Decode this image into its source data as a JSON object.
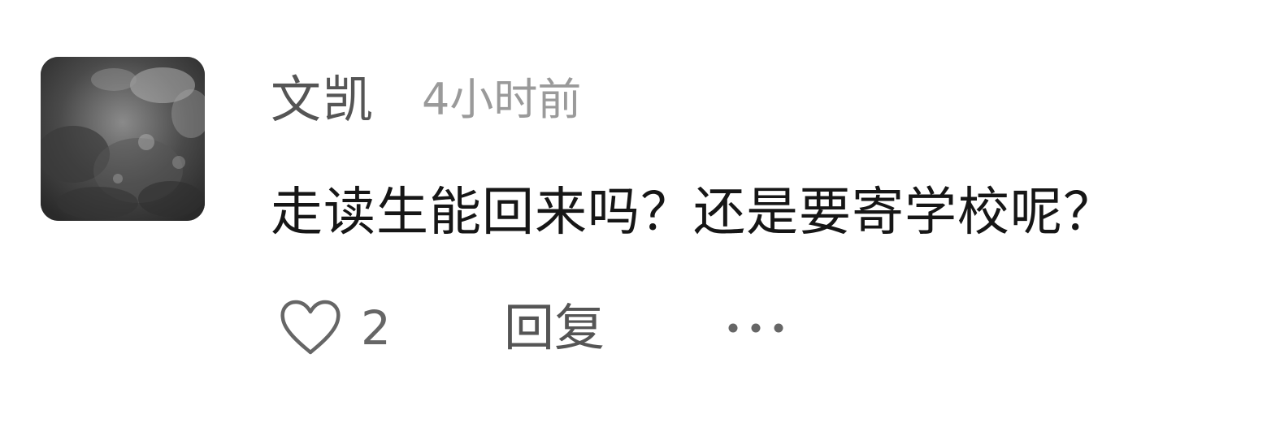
{
  "comment": {
    "author": "文凯",
    "timestamp": "4小时前",
    "text": "走读生能回来吗？还是要寄学校呢？",
    "likes": "2",
    "reply_label": "回复",
    "avatar_icon": "user-avatar-photo",
    "like_icon": "heart-outline-icon",
    "more_icon": "more-dots-icon"
  },
  "colors": {
    "author": "#555555",
    "timestamp": "#9a9a9a",
    "text": "#161616",
    "actions": "#666666",
    "background": "#ffffff"
  }
}
